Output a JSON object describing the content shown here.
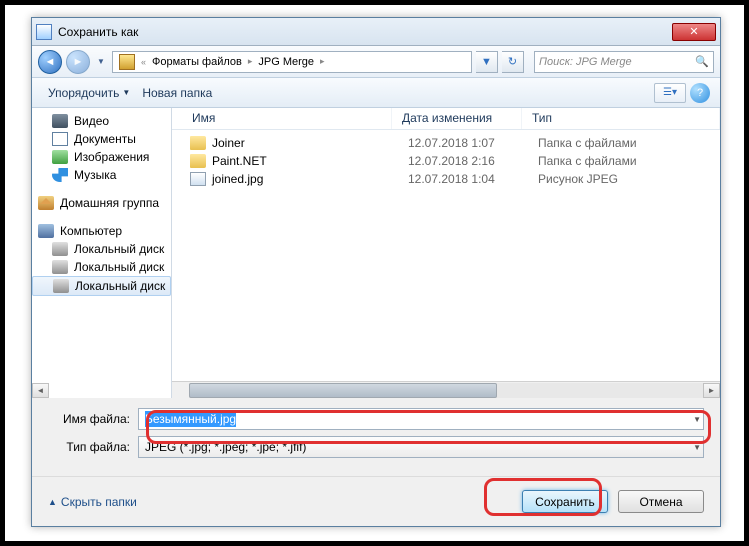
{
  "window": {
    "title": "Сохранить как",
    "close_glyph": "✕"
  },
  "nav": {
    "back_glyph": "◄",
    "fwd_glyph": "►",
    "drop_glyph": "▼",
    "crumb_prefix": "«",
    "crumbs": [
      "Форматы файлов",
      "JPG Merge"
    ],
    "sep": "▸",
    "refresh_glyph": "↻",
    "search_placeholder": "Поиск: JPG Merge",
    "search_icon": "🔍"
  },
  "toolbar": {
    "organize": "Упорядочить",
    "new_folder": "Новая папка",
    "arrow": "▼",
    "view_glyph": "☰▾",
    "help_glyph": "?"
  },
  "tree": {
    "items_top": [
      {
        "icon": "video",
        "label": "Видео"
      },
      {
        "icon": "doc",
        "label": "Документы"
      },
      {
        "icon": "img",
        "label": "Изображения"
      },
      {
        "icon": "music",
        "label": "Музыка"
      }
    ],
    "homegroup": "Домашняя группа",
    "computer": "Компьютер",
    "disks": [
      {
        "label": "Локальный диск"
      },
      {
        "label": "Локальный диск"
      },
      {
        "label": "Локальный диск",
        "selected": true
      }
    ]
  },
  "list": {
    "columns": {
      "name": "Имя",
      "date": "Дата изменения",
      "type": "Тип"
    },
    "rows": [
      {
        "icon": "folder",
        "name": "Joiner",
        "date": "12.07.2018 1:07",
        "type": "Папка с файлами"
      },
      {
        "icon": "folder",
        "name": "Paint.NET",
        "date": "12.07.2018 2:16",
        "type": "Папка с файлами"
      },
      {
        "icon": "jpg",
        "name": "joined.jpg",
        "date": "12.07.2018 1:04",
        "type": "Рисунок JPEG"
      }
    ]
  },
  "form": {
    "filename_label": "Имя файла:",
    "filename_value": "Безымянный.jpg",
    "filetype_label": "Тип файла:",
    "filetype_value": "JPEG (*.jpg; *.jpeg; *.jpe; *.jfif)"
  },
  "footer": {
    "hide_folders": "Скрыть папки",
    "hide_arrow": "▲",
    "save": "Сохранить",
    "cancel": "Отмена"
  }
}
